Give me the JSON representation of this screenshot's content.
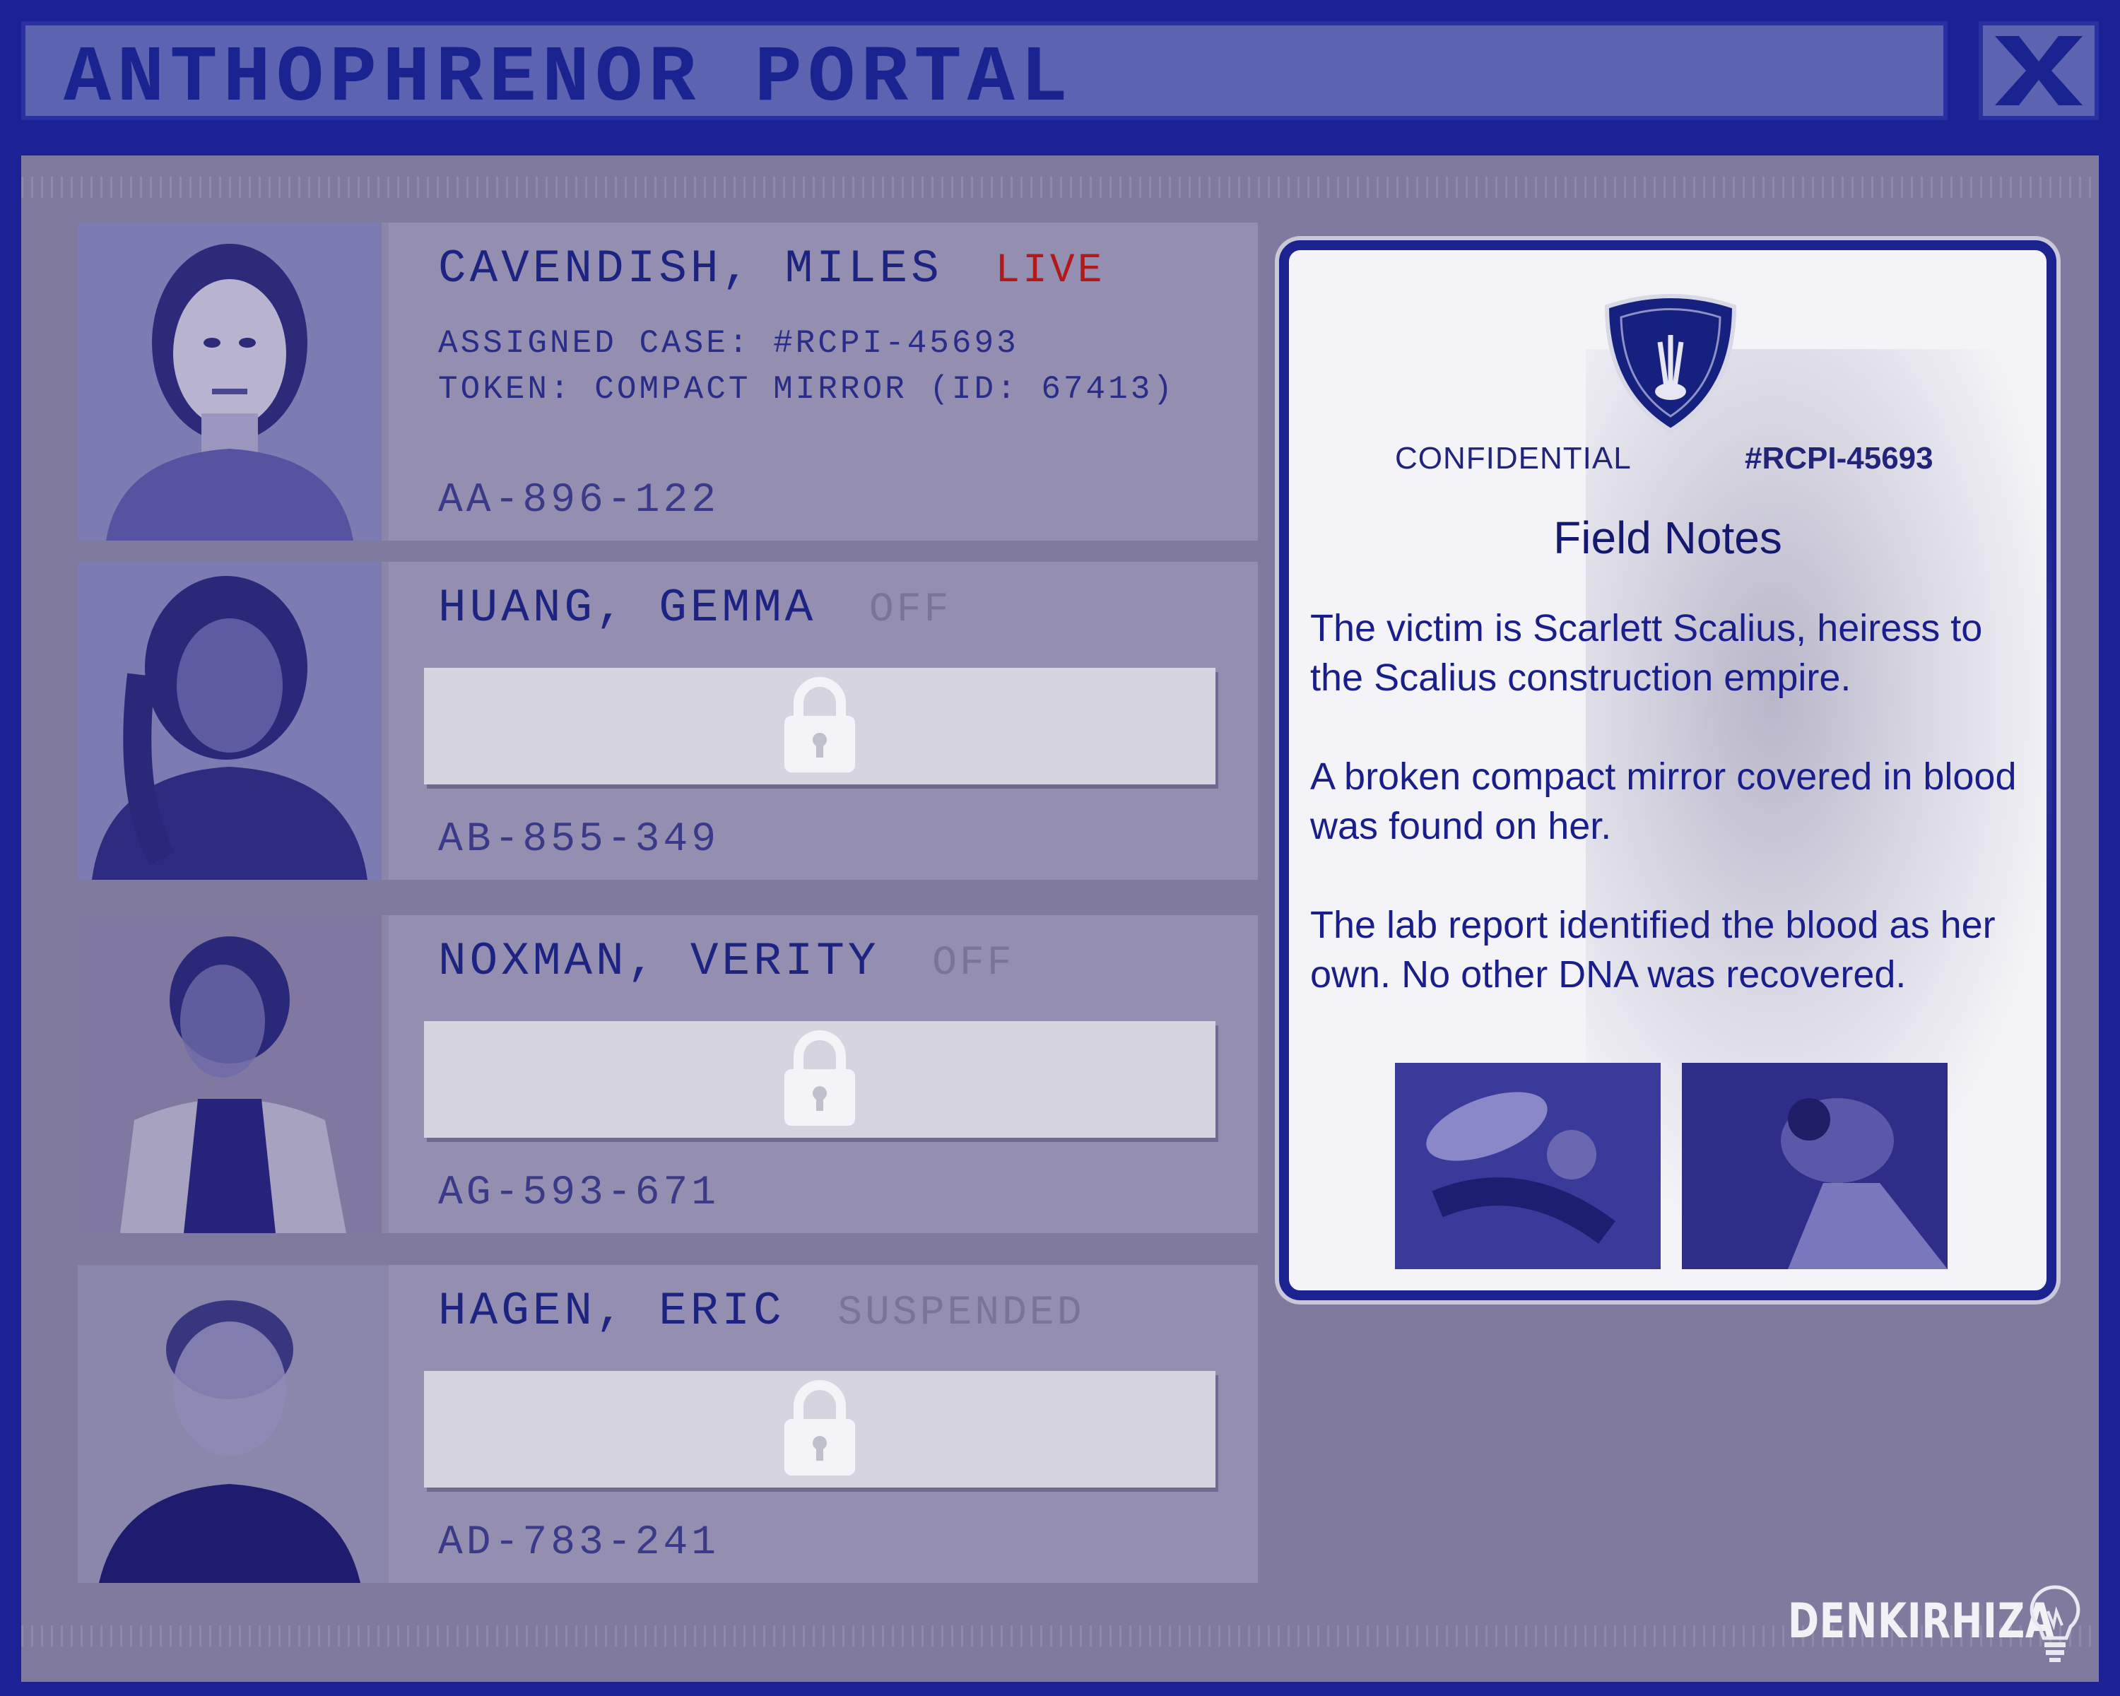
{
  "window": {
    "title": "ANTHOPHRENOR PORTAL",
    "close_icon": "x-close-icon"
  },
  "suspects": [
    {
      "name": "CAVENDISH, MILES",
      "status": "LIVE",
      "assigned_case": "ASSIGNED CASE: #RCPI-45693",
      "token": "TOKEN: COMPACT MIRROR (ID: 67413)",
      "code": "AA-896-122",
      "locked": false
    },
    {
      "name": "HUANG, GEMMA",
      "status": "OFF",
      "code": "AB-855-349",
      "locked": true
    },
    {
      "name": "NOXMAN, VERITY",
      "status": "OFF",
      "code": "AG-593-671",
      "locked": true
    },
    {
      "name": "HAGEN, ERIC",
      "status": "SUSPENDED",
      "code": "AD-783-241",
      "locked": true
    }
  ],
  "notes": {
    "classification": "CONFIDENTIAL",
    "case_number": "#RCPI-45693",
    "title": "Field Notes",
    "paragraphs": [
      "The victim is Scarlett Scalius, heiress to the Scalius construction empire.",
      "A broken compact mirror covered in blood was found on her.",
      "The lab report identified the blood as her own. No other DNA was recovered."
    ],
    "badge_icon": "police-shield-icon"
  },
  "brand": {
    "logo_text": "DENKIRHIZA",
    "logo_icon": "lightbulb-icon"
  },
  "colors": {
    "frame": "#1c2296",
    "panel": "#807a9e",
    "text_dark": "#1d2380",
    "live": "#b01a1a",
    "notes_bg": "#f4f4f8"
  }
}
